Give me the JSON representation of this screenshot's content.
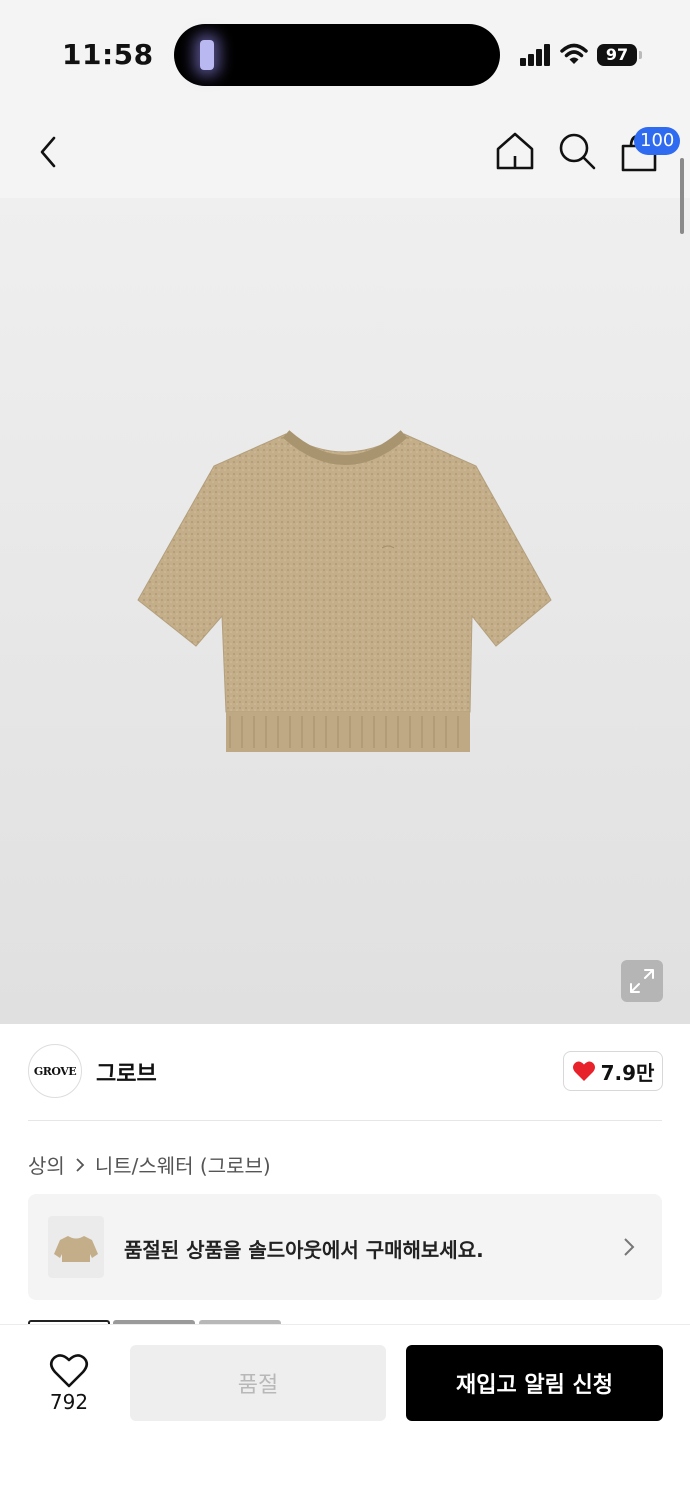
{
  "status_bar": {
    "time": "11:58",
    "battery": "97"
  },
  "header": {
    "cart_count": "100"
  },
  "brand": {
    "logo_text": "GROVE",
    "name": "그로브",
    "like_count": "7.9만"
  },
  "breadcrumb": {
    "category": "상의",
    "subcategory": "니트/스웨터 (그로브)"
  },
  "banner": {
    "text": "품절된 상품을 솔드아웃에서 구매해보세요."
  },
  "bottom_bar": {
    "wish_count": "792",
    "soldout_label": "품절",
    "restock_label": "재입고 알림 신청"
  },
  "colors": {
    "accent": "#2f6bf0",
    "heart": "#e8222a",
    "primary_button": "#000000",
    "disabled_button": "#eeeeee"
  }
}
